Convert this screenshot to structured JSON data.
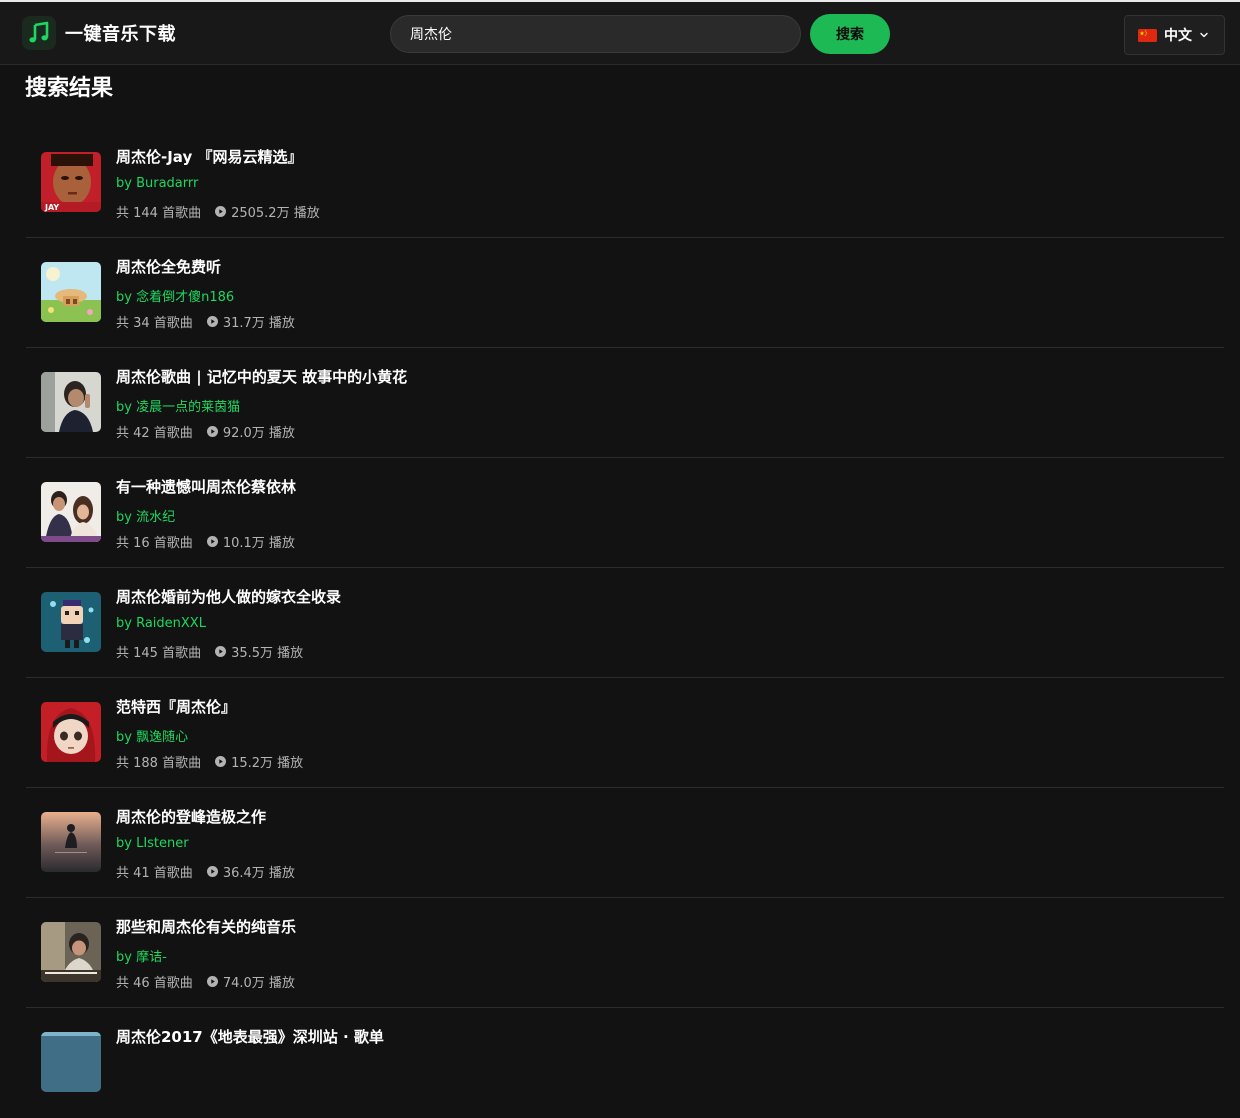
{
  "app": {
    "title": "一键音乐下载"
  },
  "search": {
    "value": "周杰伦",
    "button_label": "搜索"
  },
  "language": {
    "selected": "中文"
  },
  "page": {
    "title": "搜索结果"
  },
  "results": [
    {
      "title": "周杰伦-Jay 『网易云精选』",
      "author": "by Buradarrr",
      "songs": "共 144 首歌曲",
      "plays": "2505.2万 播放"
    },
    {
      "title": "周杰伦全免费听",
      "author": "by 念着倒才傻n186",
      "songs": "共 34 首歌曲",
      "plays": "31.7万 播放"
    },
    {
      "title": "周杰伦歌曲 | 记忆中的夏天 故事中的小黄花",
      "author": "by 凌晨一点的莱茵猫",
      "songs": "共 42 首歌曲",
      "plays": "92.0万 播放"
    },
    {
      "title": "有一种遗憾叫周杰伦蔡依林",
      "author": "by 流水纪",
      "songs": "共 16 首歌曲",
      "plays": "10.1万 播放"
    },
    {
      "title": "周杰伦婚前为他人做的嫁衣全收录",
      "author": "by RaidenXXL",
      "songs": "共 145 首歌曲",
      "plays": "35.5万 播放"
    },
    {
      "title": "范特西『周杰伦』",
      "author": "by 飘逸随心",
      "songs": "共 188 首歌曲",
      "plays": "15.2万 播放"
    },
    {
      "title": "周杰伦的登峰造极之作",
      "author": "by LIstener",
      "songs": "共 41 首歌曲",
      "plays": "36.4万 播放"
    },
    {
      "title": "那些和周杰伦有关的纯音乐",
      "author": "by 摩诘-",
      "songs": "共 46 首歌曲",
      "plays": "74.0万 播放"
    },
    {
      "title": "周杰伦2017《地表最强》深圳站 · 歌单",
      "author": "",
      "songs": "",
      "plays": ""
    }
  ],
  "colors": {
    "accent": "#1db954",
    "background": "#121212",
    "header": "#181818",
    "author": "#1ed760",
    "meta": "#b3b3b3"
  },
  "icons": {
    "logo": "music-note-icon",
    "flag": "china-flag-icon",
    "dropdown": "chevron-down-icon",
    "play": "play-circle-icon"
  }
}
